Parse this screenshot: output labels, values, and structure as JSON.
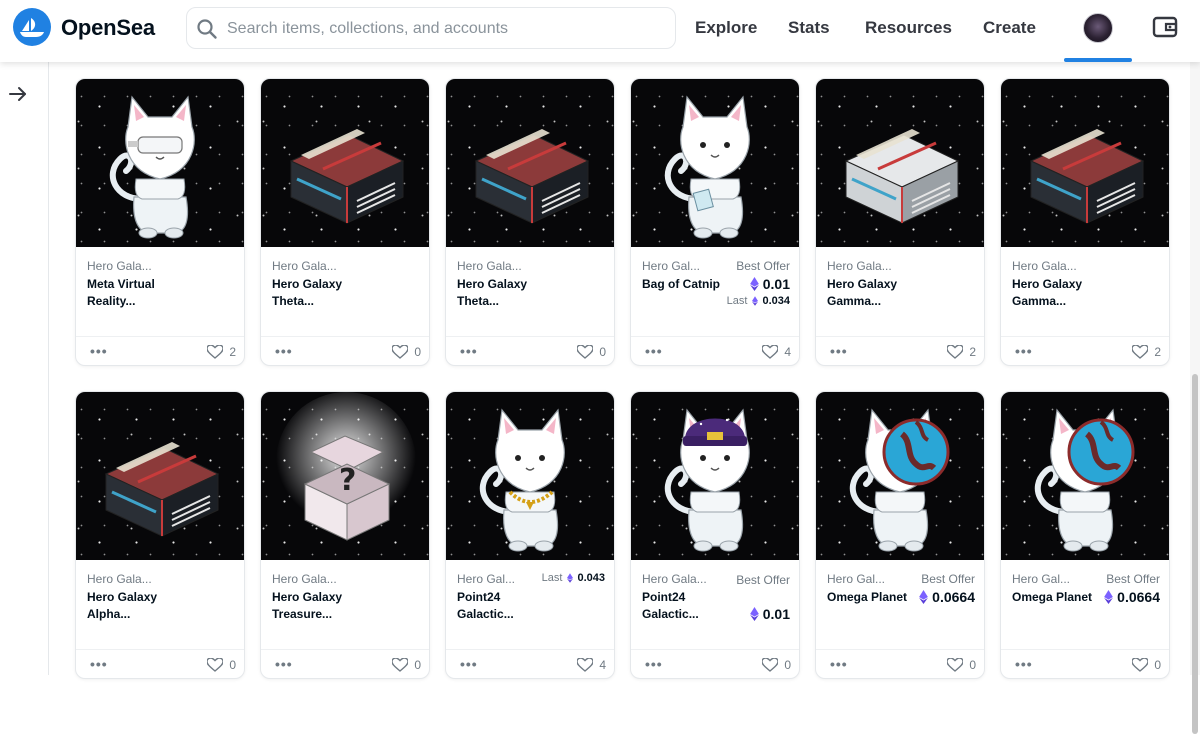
{
  "header": {
    "brand": "OpenSea",
    "search_placeholder": "Search items, collections, and accounts",
    "nav": [
      "Explore",
      "Stats",
      "Resources",
      "Create"
    ]
  },
  "colors": {
    "accent": "#2081e2",
    "eth": "#7b61ff"
  },
  "cards": [
    {
      "collection": "Hero Gala...",
      "name": "Meta Virtual Reality...",
      "art": "cat-vr",
      "likes": "2"
    },
    {
      "collection": "Hero Gala...",
      "name": "Hero Galaxy Theta...",
      "art": "crate-red",
      "likes": "0"
    },
    {
      "collection": "Hero Gala...",
      "name": "Hero Galaxy Theta...",
      "art": "crate-red",
      "likes": "0"
    },
    {
      "collection": "Hero Gal...",
      "name": "Bag of Catnip",
      "art": "cat-catnip",
      "price_label": "Best Offer",
      "price": "0.01",
      "last_label": "Last",
      "last_price": "0.034",
      "likes": "4"
    },
    {
      "collection": "Hero Gala...",
      "name": "Hero Galaxy Gamma...",
      "art": "crate-silver",
      "likes": "2"
    },
    {
      "collection": "Hero Gala...",
      "name": "Hero Galaxy Gamma...",
      "art": "crate-red",
      "likes": "2"
    },
    {
      "collection": "Hero Gala...",
      "name": "Hero Galaxy Alpha...",
      "art": "crate-red",
      "likes": "0"
    },
    {
      "collection": "Hero Gala...",
      "name": "Hero Galaxy Treasure...",
      "art": "crate-mystery",
      "likes": "0"
    },
    {
      "collection": "Hero Gal...",
      "name": "Point24 Galactic...",
      "art": "cat-chain",
      "last_label": "Last",
      "last_price": "0.043",
      "likes": "4"
    },
    {
      "collection": "Hero Gala...",
      "name": "Point24 Galactic...",
      "art": "cat-beanie",
      "price_label": "Best Offer",
      "price": "0.01",
      "likes": "0"
    },
    {
      "collection": "Hero Gal...",
      "name": "Omega Planet",
      "art": "cat-planet",
      "price_label": "Best Offer",
      "price": "0.0664",
      "likes": "0"
    },
    {
      "collection": "Hero Gal...",
      "name": "Omega Planet",
      "art": "cat-planet",
      "price_label": "Best Offer",
      "price": "0.0664",
      "likes": "0"
    }
  ]
}
